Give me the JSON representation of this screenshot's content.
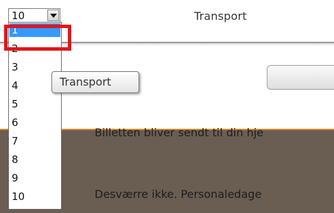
{
  "header": {
    "title": "Transport"
  },
  "select": {
    "value": "10",
    "options": [
      "1",
      "2",
      "3",
      "4",
      "5",
      "6",
      "7",
      "8",
      "9",
      "10"
    ],
    "highlighted": "1"
  },
  "tooltip": {
    "text": "Transport"
  },
  "content": {
    "line1": "Billetten bliver sendt til din hje",
    "line2": "Desværre ikke. Personaledage"
  },
  "colors": {
    "highlight_border": "#e3151a",
    "selected_option": "#3399ff",
    "dark_band": "#6a5d52",
    "accent_line": "#d08a2a"
  }
}
